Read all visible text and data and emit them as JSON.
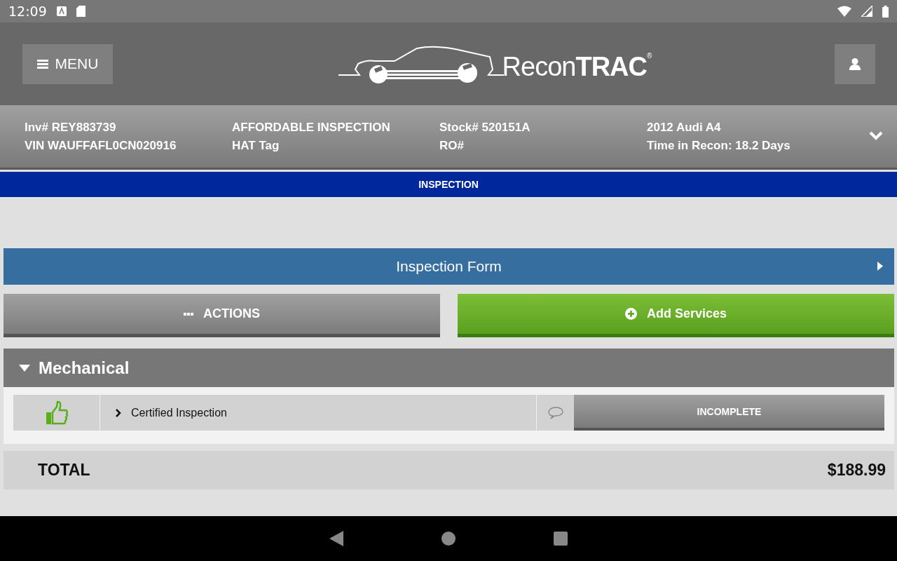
{
  "status_bar": {
    "time": "12:09"
  },
  "header": {
    "menu_label": "MENU",
    "logo": "Recon**TRAC**$^{®}$"
  },
  "vehicle_info": {
    "columns": [
      {
        "line_1": "Inv# REY883739",
        "line_2": "VIN WAUFFAFL0CN020916"
      },
      {
        "line_1": "AFFORDABLE INSPECTION",
        "line_2": "HAT Tag"
      },
      {
        "line_1": "Stock# 520151A",
        "line_2": "RO#"
      },
      {
        "line_1": "2012 Audi A4",
        "line_2": "Time in Recon: 18.2 Days"
      }
    ],
    "expanded": false
  },
  "tabs": [
    {
      "label": "INSPECTION",
      "selected": true
    }
  ],
  "form_link": {
    "label": "Inspection Form"
  },
  "buttons": [
    {
      "kind": "actions",
      "label": "ACTIONS"
    },
    {
      "kind": "add",
      "label": "Add Services"
    }
  ],
  "sections": [
    {
      "title": "Mechanical",
      "expanded": true,
      "items": [
        {
          "name": "Certified Inspection",
          "approved": true,
          "status": "INCOMPLETE"
        }
      ]
    }
  ],
  "total": {
    "label": "TOTAL",
    "amount": "$188.99"
  }
}
